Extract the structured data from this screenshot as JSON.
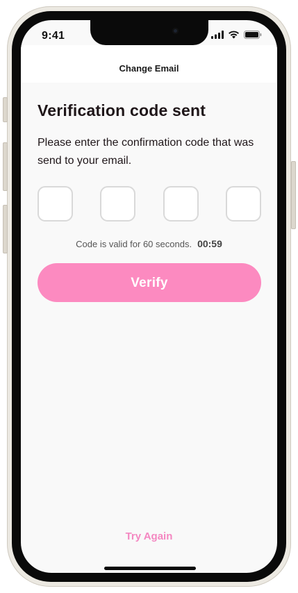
{
  "status_bar": {
    "time": "9:41"
  },
  "header": {
    "title": "Change Email"
  },
  "content": {
    "heading": "Verification code sent",
    "instructions": "Please enter the confirmation code  that was send to your email.",
    "code_boxes": [
      "",
      "",
      "",
      ""
    ],
    "validity_text": "Code is valid for 60 seconds.",
    "timer": "00:59",
    "verify_label": "Verify",
    "try_again_label": "Try Again"
  },
  "colors": {
    "accent": "#fc8ac0",
    "link": "#f487c1",
    "text": "#1f1619",
    "background": "#f9f9f9"
  },
  "icons": [
    "cellular-signal-icon",
    "wifi-icon",
    "battery-icon"
  ]
}
